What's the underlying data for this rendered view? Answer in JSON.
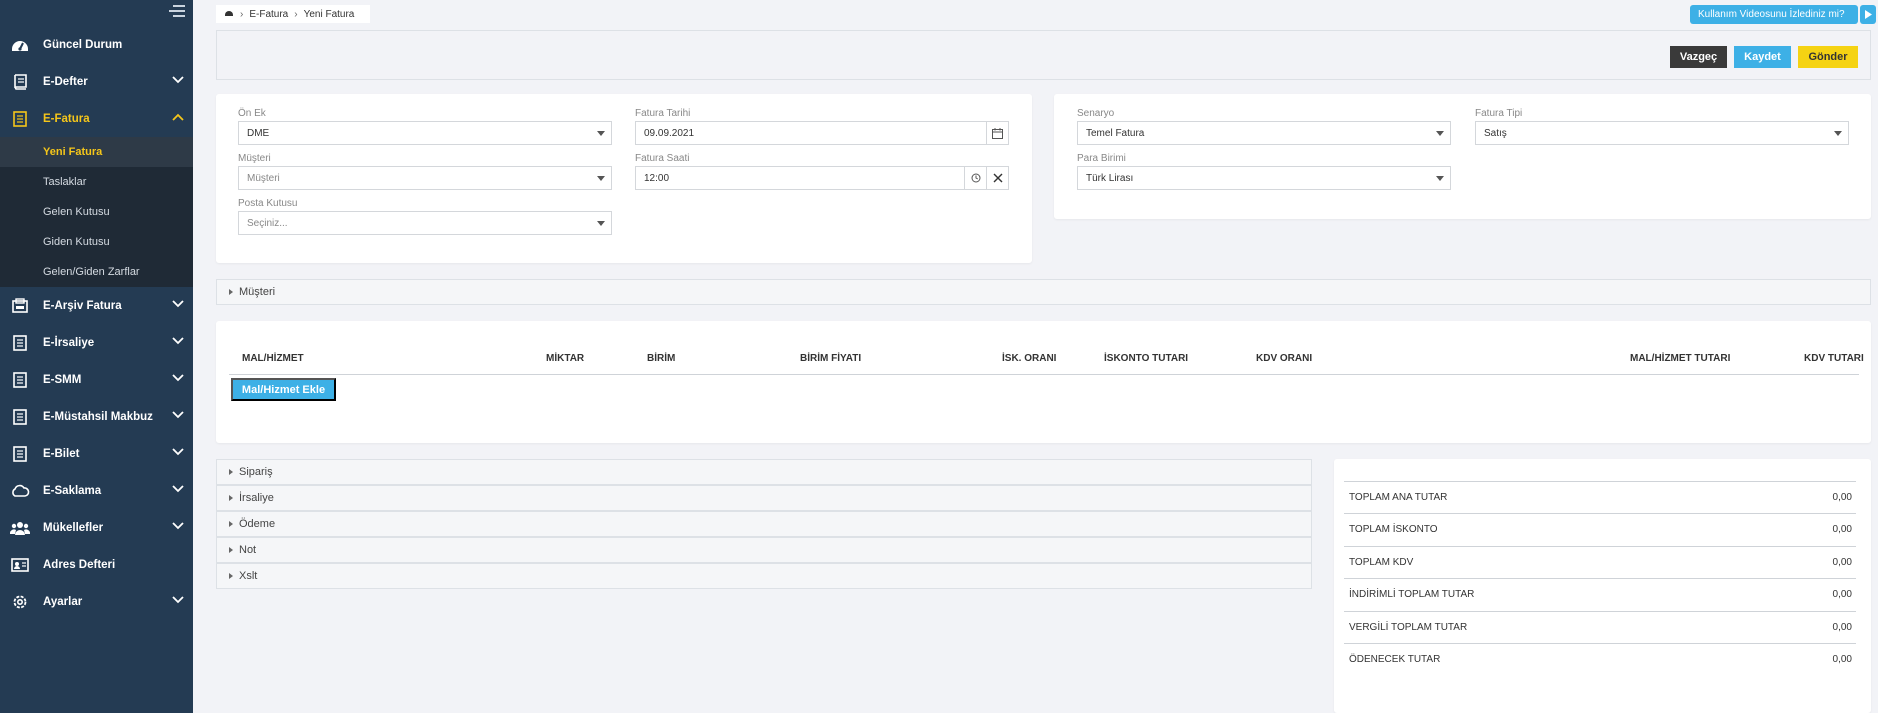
{
  "sidebar": {
    "items": [
      {
        "label": "Güncel Durum",
        "icon": "dashboard-icon",
        "has_chevron": false
      },
      {
        "label": "E-Defter",
        "icon": "book-icon",
        "has_chevron": true
      },
      {
        "label": "E-Fatura",
        "icon": "invoice-icon",
        "has_chevron": true,
        "active": true
      },
      {
        "label": "E-Arşiv Fatura",
        "icon": "archive-invoice-icon",
        "has_chevron": true
      },
      {
        "label": "E-İrsaliye",
        "icon": "dispatch-icon",
        "has_chevron": true
      },
      {
        "label": "E-SMM",
        "icon": "receipt-icon",
        "has_chevron": true
      },
      {
        "label": "E-Müstahsil Makbuz",
        "icon": "receipt-icon",
        "has_chevron": true
      },
      {
        "label": "E-Bilet",
        "icon": "ticket-icon",
        "has_chevron": true
      },
      {
        "label": "E-Saklama",
        "icon": "cloud-icon",
        "has_chevron": true
      },
      {
        "label": "Mükellefler",
        "icon": "users-icon",
        "has_chevron": true
      },
      {
        "label": "Adres Defteri",
        "icon": "address-card-icon",
        "has_chevron": false
      },
      {
        "label": "Ayarlar",
        "icon": "gear-icon",
        "has_chevron": true
      }
    ],
    "efatura_submenu": [
      "Yeni Fatura",
      "Taslaklar",
      "Gelen Kutusu",
      "Giden Kutusu",
      "Gelen/Giden Zarflar"
    ]
  },
  "breadcrumb": {
    "items": [
      "E-Fatura",
      "Yeni Fatura"
    ]
  },
  "video_button": {
    "label": "Kullanım Videosunu İzlediniz mi?"
  },
  "actions": {
    "cancel": "Vazgeç",
    "save": "Kaydet",
    "send": "Gönder"
  },
  "form_left": {
    "on_ek": {
      "label": "Ön Ek",
      "value": "DME"
    },
    "fatura_tarihi": {
      "label": "Fatura Tarihi",
      "value": "09.09.2021"
    },
    "musteri": {
      "label": "Müşteri",
      "placeholder": "Müşteri"
    },
    "fatura_saati": {
      "label": "Fatura Saati",
      "value": "12:00"
    },
    "posta_kutusu": {
      "label": "Posta Kutusu",
      "placeholder": "Seçiniz..."
    }
  },
  "form_right": {
    "senaryo": {
      "label": "Senaryo",
      "value": "Temel Fatura"
    },
    "fatura_tipi": {
      "label": "Fatura Tipi",
      "value": "Satış"
    },
    "para_birimi": {
      "label": "Para Birimi",
      "value": "Türk Lirası"
    }
  },
  "musteri_section": {
    "label": "Müşteri"
  },
  "items_table": {
    "columns": [
      "MAL/HİZMET",
      "MİKTAR",
      "BİRİM",
      "BİRİM FİYATI",
      "İSK. ORANI",
      "İSKONTO TUTARI",
      "KDV ORANI",
      "MAL/HİZMET TUTARI",
      "KDV TUTARI"
    ],
    "add_button": "Mal/Hizmet Ekle"
  },
  "sections": [
    "Sipariş",
    "İrsaliye",
    "Ödeme",
    "Not",
    "Xslt"
  ],
  "totals": [
    {
      "label": "TOPLAM ANA TUTAR",
      "value": "0,00"
    },
    {
      "label": "TOPLAM İSKONTO",
      "value": "0,00"
    },
    {
      "label": "TOPLAM KDV",
      "value": "0,00"
    },
    {
      "label": "İNDİRİMLİ TOPLAM TUTAR",
      "value": "0,00"
    },
    {
      "label": "VERGİLİ TOPLAM TUTAR",
      "value": "0,00"
    },
    {
      "label": "ÖDENECEK TUTAR",
      "value": "0,00"
    }
  ],
  "colors": {
    "sidebar_bg": "#243b53",
    "accent_yellow": "#f5c61a",
    "accent_blue": "#3db0e6",
    "dark_button": "#3a3a3a"
  }
}
